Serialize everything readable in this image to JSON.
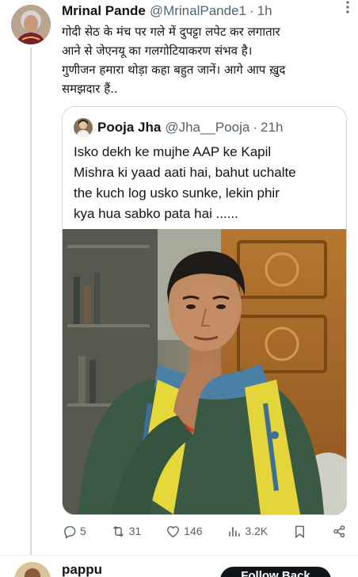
{
  "tweet": {
    "author_name": "Mrinal Pande",
    "author_handle": "@MrinalPande1",
    "separator": "·",
    "time": "1h",
    "more_icon": "more-vertical-icon",
    "text": "गोदी सेठ के मंच पर गले में दुपट्टा लपेट कर लगातार\nआने से जेएनयू का गलगोटियाकरण संभव है।\nगुणीजन हमारा थोड़ा कहा बहुत जानें। आगे आप ख़ुद\nसमझदार हैं.."
  },
  "quoted_tweet": {
    "author_name": "Pooja Jha",
    "author_handle": "@Jha__Pooja",
    "separator": "·",
    "time": "21h",
    "text": "Isko dekh ke mujhe AAP ke Kapil\nMishra ki yaad aati hai, bahut uchalte\nthe kuch log usko sunke, lekin phir\nkya hua sabko pata hai ......"
  },
  "actions": {
    "reply": {
      "icon": "reply-icon",
      "count": "5"
    },
    "retweet": {
      "icon": "retweet-icon",
      "count": "31"
    },
    "like": {
      "icon": "heart-icon",
      "count": "146"
    },
    "views": {
      "icon": "views-icon",
      "count": "3.2K"
    },
    "bookmark": {
      "icon": "bookmark-icon"
    },
    "share": {
      "icon": "share-icon"
    }
  },
  "next_item": {
    "name": "pappu",
    "follow_label": "Follow Back"
  },
  "colors": {
    "text_primary": "#0f1419",
    "text_secondary": "#536471",
    "border": "#cfd9de",
    "button_bg": "#0f1419"
  }
}
